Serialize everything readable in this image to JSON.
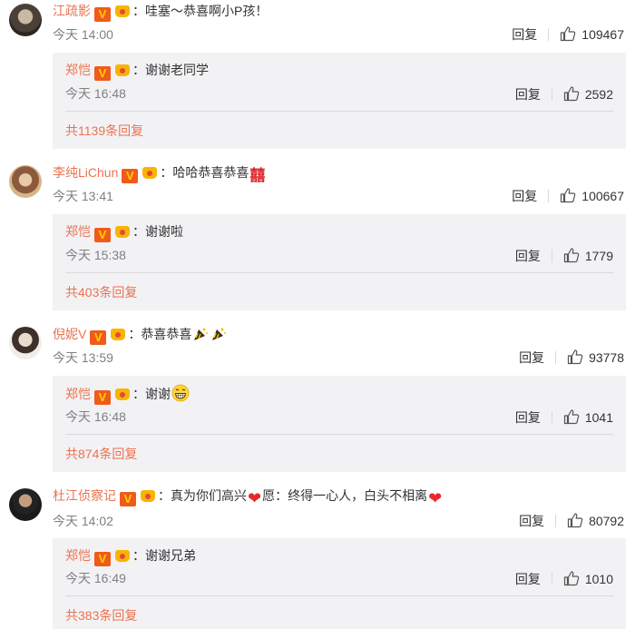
{
  "comments": [
    {
      "user": "江疏影",
      "badge": "V",
      "text": "哇塞～恭喜啊小P孩！",
      "time": "今天 14:00",
      "reply_label": "回复",
      "likes": "109467",
      "reply": {
        "user": "郑恺",
        "badge": "V",
        "text": "谢谢老同学",
        "time": "今天 16:48",
        "reply_label": "回复",
        "likes": "2592"
      },
      "more": "共1139条回复"
    },
    {
      "user": "李纯LiChun",
      "badge": "V",
      "text": "哈哈恭喜恭喜",
      "time": "今天 13:41",
      "reply_label": "回复",
      "likes": "100667",
      "reply": {
        "user": "郑恺",
        "badge": "V",
        "text": "谢谢啦",
        "time": "今天 15:38",
        "reply_label": "回复",
        "likes": "1779"
      },
      "more": "共403条回复"
    },
    {
      "user": "倪妮V",
      "badge": "V",
      "text": "恭喜恭喜",
      "time": "今天 13:59",
      "reply_label": "回复",
      "likes": "93778",
      "reply": {
        "user": "郑恺",
        "badge": "V",
        "text": "谢谢",
        "time": "今天 16:48",
        "reply_label": "回复",
        "likes": "1041"
      },
      "more": "共874条回复"
    },
    {
      "user": "杜江侦察记",
      "badge": "V",
      "text": "真为你们高兴",
      "text2": "愿：终得一心人，白头不相离",
      "time": "今天 14:02",
      "reply_label": "回复",
      "likes": "80792",
      "reply": {
        "user": "郑恺",
        "badge": "V",
        "text": "谢谢兄弟",
        "time": "今天 16:49",
        "reply_label": "回复",
        "likes": "1010"
      },
      "more": "共383条回复"
    }
  ],
  "colors": {
    "username": "#eb7350",
    "reply_box_bg": "#f2f2f5",
    "meta_text": "#808080"
  },
  "icons": [
    "like-icon",
    "verified-badge-icon",
    "member-crown-icon",
    "double-happiness-icon",
    "party-popper-icon",
    "grin-emoji-icon",
    "heart-icon"
  ]
}
